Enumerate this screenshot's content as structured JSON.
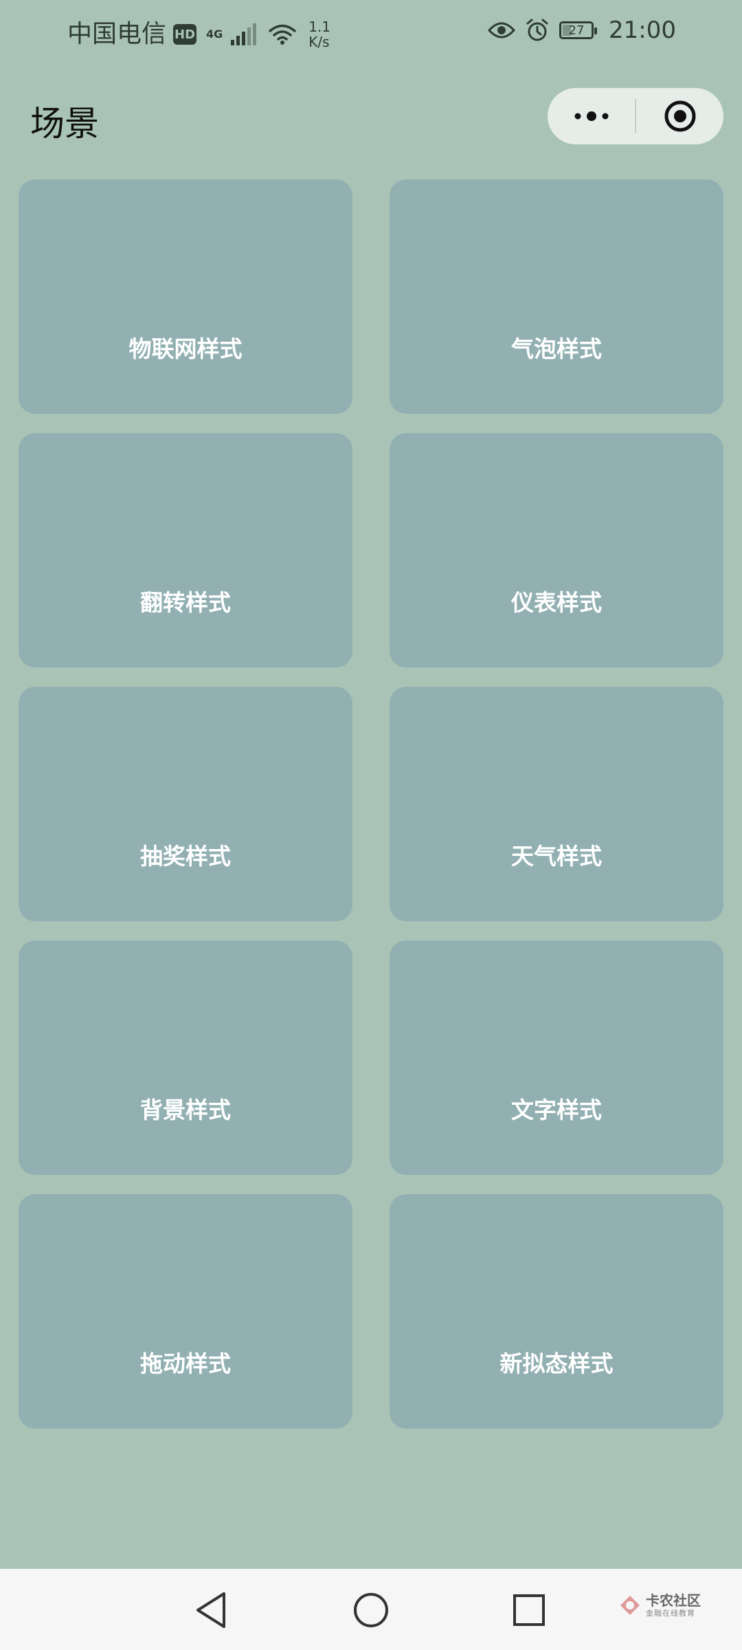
{
  "status_bar": {
    "carrier": "中国电信",
    "hd": "HD",
    "network": "4G",
    "speed_value": "1.1",
    "speed_unit": "K/s",
    "battery": "27",
    "time": "21:00"
  },
  "header": {
    "title": "场景"
  },
  "cards": [
    {
      "label": "物联网样式"
    },
    {
      "label": "气泡样式"
    },
    {
      "label": "翻转样式"
    },
    {
      "label": "仪表样式"
    },
    {
      "label": "抽奖样式"
    },
    {
      "label": "天气样式"
    },
    {
      "label": "背景样式"
    },
    {
      "label": "文字样式"
    },
    {
      "label": "拖动样式"
    },
    {
      "label": "新拟态样式"
    }
  ],
  "watermark": {
    "main": "卡农社区",
    "sub": "金融在线教育"
  },
  "colors": {
    "background": "#a9c4b6",
    "card": "#92b0b2",
    "card_text": "#ffffff",
    "capsule": "#e6ece8",
    "nav_bar": "#f6f6f6"
  }
}
